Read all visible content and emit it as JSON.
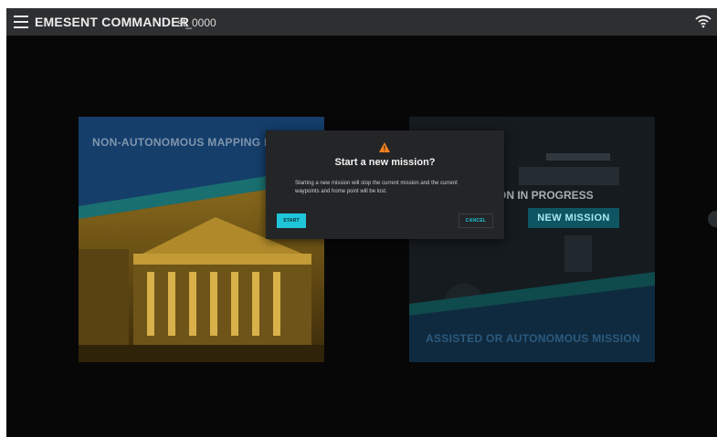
{
  "header": {
    "app_title": "EMESENT COMMANDER",
    "station_id": "st_0000"
  },
  "icons": {
    "menu": "hamburger-menu-icon",
    "wifi": "wifi-icon",
    "warning": "warning-triangle-icon"
  },
  "mapping_card": {
    "title": "NON-AUTONOMOUS MAPPING I"
  },
  "autonomous_card": {
    "in_progress_label": "ON IN PROGRESS",
    "new_mission_label": "NEW MISSION",
    "bottom_label": "ASSISTED OR AUTONOMOUS MISSION"
  },
  "dialog": {
    "title": "Start a new mission?",
    "message": "Starting a new mission will stop the current mission and the current waypoints and home point will be lost.",
    "start_label": "START",
    "cancel_label": "CANCEL"
  },
  "colors": {
    "accent": "#1fc5d9",
    "warning": "#f5821f",
    "topbar": "#2e2f31"
  }
}
